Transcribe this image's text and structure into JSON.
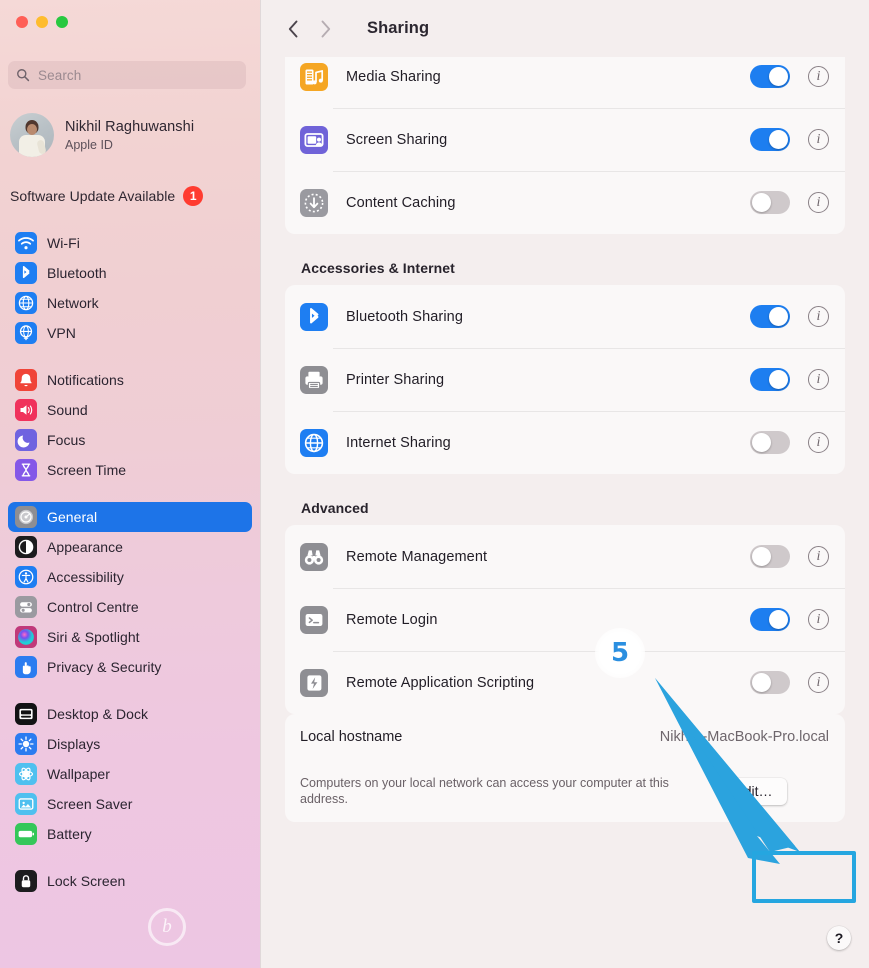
{
  "window": {
    "traffic_lights": [
      "close",
      "minimize",
      "zoom"
    ]
  },
  "sidebar": {
    "search": {
      "placeholder": "Search",
      "value": "",
      "icon": "search-icon"
    },
    "account": {
      "name": "Nikhil Raghuwanshi",
      "subtitle": "Apple ID",
      "avatar_icon": "user-photo-avatar"
    },
    "update": {
      "label": "Software Update Available",
      "badge_count": "1",
      "badge_color": "#ff3b30"
    },
    "selected_color": "#1d74e8",
    "groups": [
      {
        "items": [
          {
            "label": "Wi-Fi",
            "icon": "wifi-icon",
            "icon_color": "#1e7ef2",
            "selected": false
          },
          {
            "label": "Bluetooth",
            "icon": "bluetooth-icon",
            "icon_color": "#1e7ef2",
            "selected": false
          },
          {
            "label": "Network",
            "icon": "globe-icon",
            "icon_color": "#1e7ef2",
            "selected": false
          },
          {
            "label": "VPN",
            "icon": "vpn-globe-icon",
            "icon_color": "#1e7ef2",
            "selected": false
          }
        ]
      },
      {
        "items": [
          {
            "label": "Notifications",
            "icon": "bell-icon",
            "icon_color": "#f04438",
            "selected": false
          },
          {
            "label": "Sound",
            "icon": "speaker-icon",
            "icon_color": "#f0325c",
            "selected": false
          },
          {
            "label": "Focus",
            "icon": "moon-icon",
            "icon_color": "#6f63e0",
            "selected": false
          },
          {
            "label": "Screen Time",
            "icon": "hourglass-icon",
            "icon_color": "#8458e8",
            "selected": false
          }
        ]
      },
      {
        "items": [
          {
            "label": "General",
            "icon": "gear-icon",
            "icon_color": "#8e8e93",
            "selected": true
          },
          {
            "label": "Appearance",
            "icon": "appearance-icon",
            "icon_color": "#1c1c1e",
            "selected": false
          },
          {
            "label": "Accessibility",
            "icon": "accessibility-icon",
            "icon_color": "#1e7ef2",
            "selected": false
          },
          {
            "label": "Control Centre",
            "icon": "control-centre-icon",
            "icon_color": "#9a9aa0",
            "selected": false
          },
          {
            "label": "Siri & Spotlight",
            "icon": "siri-icon",
            "icon_color": "#c0397a",
            "selected": false
          },
          {
            "label": "Privacy & Security",
            "icon": "hand-icon",
            "icon_color": "#2b7cf0",
            "selected": false
          }
        ]
      },
      {
        "items": [
          {
            "label": "Desktop & Dock",
            "icon": "desktop-dock-icon",
            "icon_color": "#121214",
            "selected": false
          },
          {
            "label": "Displays",
            "icon": "brightness-icon",
            "icon_color": "#2b7cf0",
            "selected": false
          },
          {
            "label": "Wallpaper",
            "icon": "wallpaper-icon",
            "icon_color": "#4fc0ef",
            "selected": false
          },
          {
            "label": "Screen Saver",
            "icon": "screen-saver-icon",
            "icon_color": "#4fc0ef",
            "selected": false
          },
          {
            "label": "Battery",
            "icon": "battery-icon",
            "icon_color": "#34c759",
            "selected": false
          }
        ]
      },
      {
        "items": [
          {
            "label": "Lock Screen",
            "icon": "lock-icon",
            "icon_color": "#1c1c1e",
            "selected": false
          }
        ]
      }
    ],
    "watermark": "b"
  },
  "toolbar": {
    "back_icon": "chevron-left-icon",
    "forward_icon": "chevron-right-icon",
    "title": "Sharing"
  },
  "main": {
    "sections": [
      {
        "title": "",
        "clipped_top": true,
        "rows": [
          {
            "label": "Media Sharing",
            "icon": "media-sharing-icon",
            "icon_color": "#f5a623",
            "toggle": "on",
            "info_icon": "info-icon"
          },
          {
            "label": "Screen Sharing",
            "icon": "screen-sharing-icon",
            "icon_color": "#7063d8",
            "toggle": "on",
            "info_icon": "info-icon"
          },
          {
            "label": "Content Caching",
            "icon": "content-caching-icon",
            "icon_color": "#9a9aa0",
            "toggle": "off",
            "info_icon": "info-icon"
          }
        ]
      },
      {
        "title": "Accessories & Internet",
        "clipped_top": false,
        "rows": [
          {
            "label": "Bluetooth Sharing",
            "icon": "bluetooth-sharing-icon",
            "icon_color": "#1e7ef2",
            "toggle": "on",
            "info_icon": "info-icon"
          },
          {
            "label": "Printer Sharing",
            "icon": "printer-icon",
            "icon_color": "#8e8e93",
            "toggle": "on",
            "info_icon": "info-icon"
          },
          {
            "label": "Internet Sharing",
            "icon": "internet-globe-icon",
            "icon_color": "#1e7ef2",
            "toggle": "off",
            "info_icon": "info-icon"
          }
        ]
      },
      {
        "title": "Advanced",
        "clipped_top": false,
        "rows": [
          {
            "label": "Remote Management",
            "icon": "binoculars-icon",
            "icon_color": "#8e8e93",
            "toggle": "off",
            "info_icon": "info-icon"
          },
          {
            "label": "Remote Login",
            "icon": "terminal-icon",
            "icon_color": "#8e8e93",
            "toggle": "on",
            "info_icon": "info-icon"
          },
          {
            "label": "Remote Application Scripting",
            "icon": "script-bolt-icon",
            "icon_color": "#8e8e93",
            "toggle": "off",
            "info_icon": "info-icon"
          }
        ]
      }
    ],
    "hostname": {
      "label": "Local hostname",
      "value": "Nikhils-MacBook-Pro.local",
      "description": "Computers on your local network can access your computer at this address.",
      "edit_label": "Edit…"
    },
    "help_label": "?"
  },
  "annotation": {
    "step_number": "5",
    "step_color": "#2b8fe0",
    "highlight_color": "#25a6e0",
    "arrow_color": "#2ba3de"
  }
}
